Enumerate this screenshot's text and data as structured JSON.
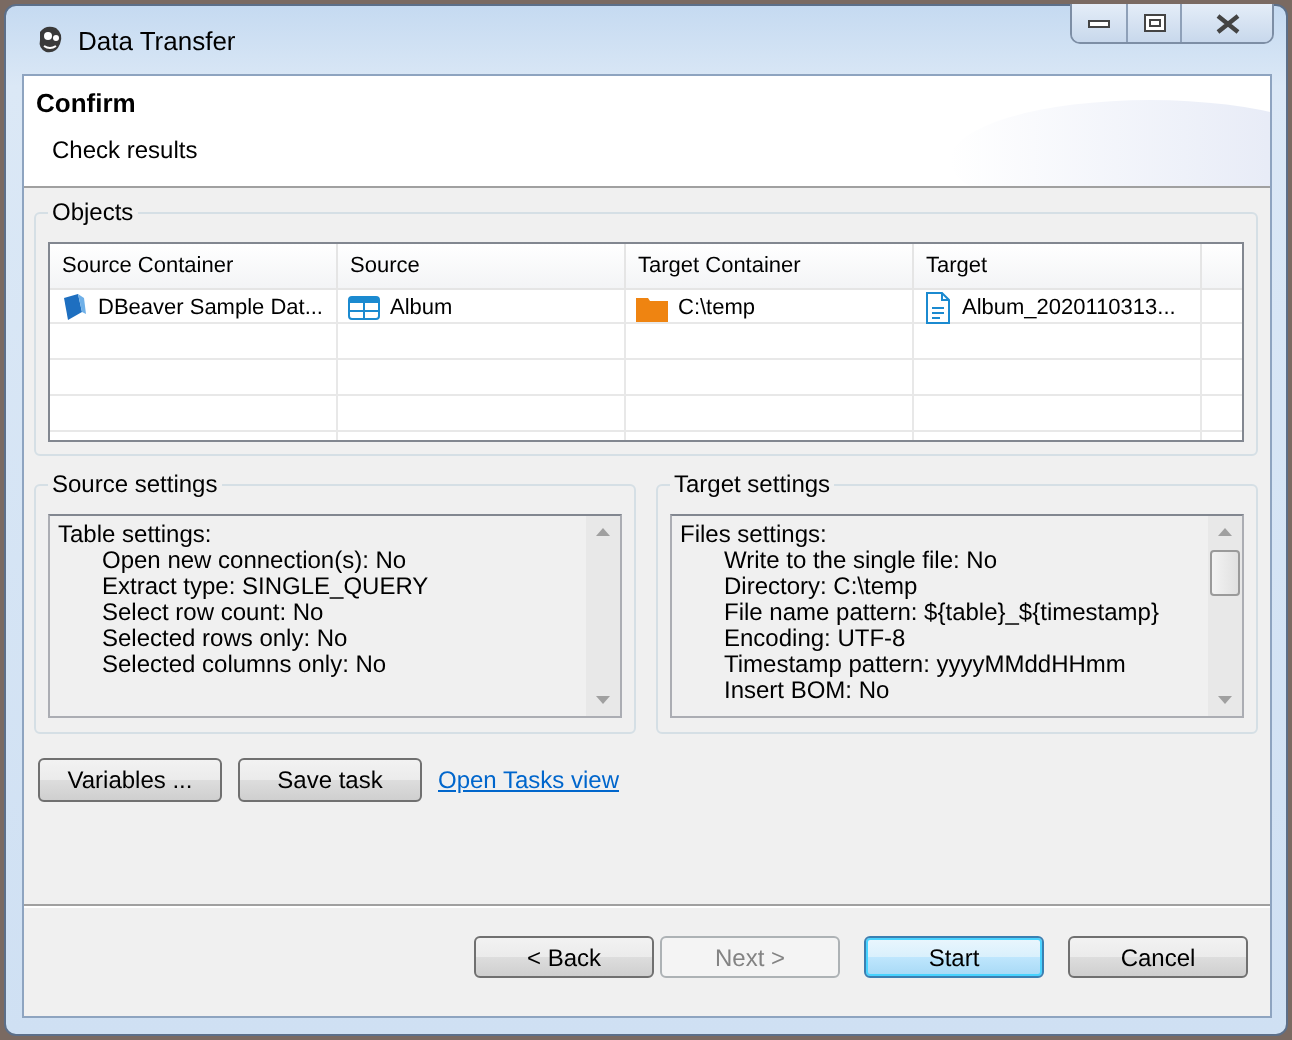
{
  "window": {
    "title": "Data Transfer"
  },
  "header": {
    "title": "Confirm",
    "subtitle": "Check results"
  },
  "objects": {
    "title": "Objects",
    "columns": [
      "Source Container",
      "Source",
      "Target Container",
      "Target"
    ],
    "rows": [
      {
        "cells": [
          {
            "text": "DBeaver Sample Dat...",
            "kind": "database"
          },
          {
            "text": "Album",
            "kind": "table"
          },
          {
            "text": "C:\\temp",
            "kind": "folder"
          },
          {
            "text": "Album_2020110313...",
            "kind": "csv"
          }
        ]
      }
    ]
  },
  "source_settings": {
    "title": "Source settings",
    "sections": [
      {
        "label": "Table settings:",
        "children": [
          {
            "label": "Open new connection(s): No"
          },
          {
            "label": "Extract type: SINGLE_QUERY"
          },
          {
            "label": "Select row count: No"
          },
          {
            "label": "Selected rows only: No"
          },
          {
            "label": "Selected columns only: No"
          }
        ]
      }
    ]
  },
  "target_settings": {
    "title": "Target settings",
    "sections": [
      {
        "label": "Files settings:",
        "children": [
          {
            "label": "Write to the single file: No"
          },
          {
            "label": "Directory: C:\\temp"
          },
          {
            "label": "File name pattern: ${table}_${timestamp}"
          },
          {
            "label": "Encoding: UTF-8"
          },
          {
            "label": "Timestamp pattern: yyyyMMddHHmm"
          },
          {
            "label": "Insert BOM: No"
          }
        ]
      }
    ]
  },
  "task_actions": [
    {
      "label": "Variables ...",
      "kind": "button"
    },
    {
      "label": "Save task",
      "kind": "button"
    },
    {
      "label": "Open Tasks view",
      "kind": "link"
    }
  ],
  "buttons": [
    {
      "label": "< Back",
      "disabled": false,
      "default": false
    },
    {
      "label": "Next >",
      "disabled": true,
      "default": false
    },
    {
      "label": "Start",
      "disabled": false,
      "default": true
    },
    {
      "label": "Cancel",
      "disabled": false,
      "default": false
    }
  ]
}
